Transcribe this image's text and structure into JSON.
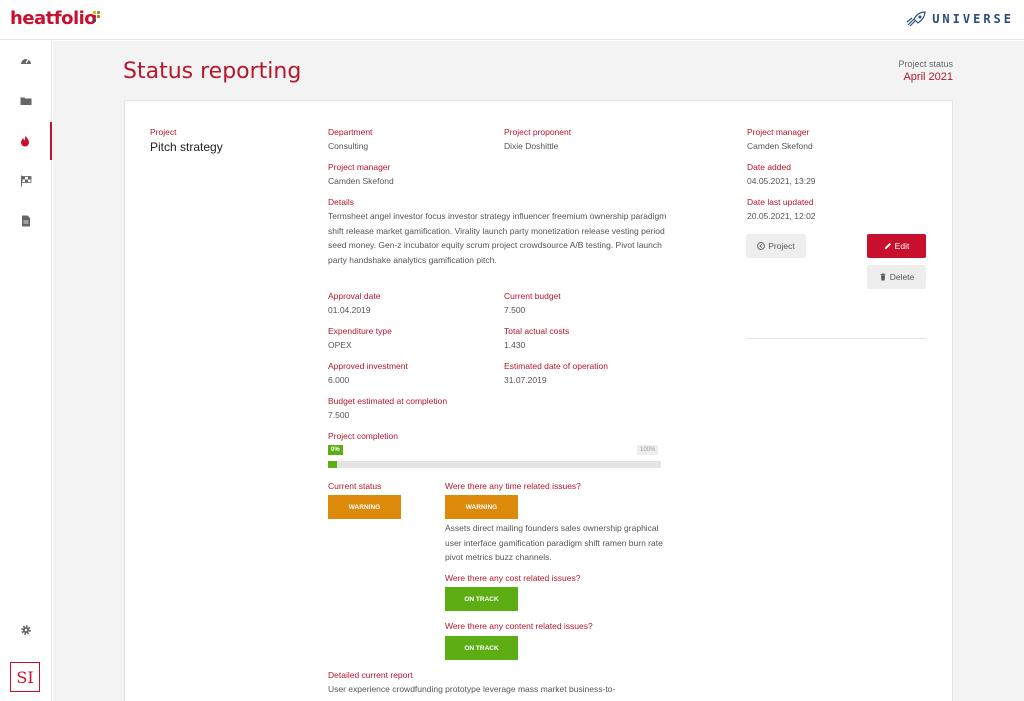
{
  "header": {
    "logo_text": "heatfolio",
    "brand_right": "UNIVERSE"
  },
  "sidebar": {
    "items": [
      {
        "icon": "dashboard-icon"
      },
      {
        "icon": "folder-icon"
      },
      {
        "icon": "flame-icon",
        "active": true
      },
      {
        "icon": "checkered-flag-icon"
      },
      {
        "icon": "document-icon"
      }
    ],
    "settings_icon": "gear-icon",
    "footer_logo": "SI"
  },
  "page": {
    "title": "Status reporting",
    "status_label": "Project status",
    "status_value": "April 2021"
  },
  "project": {
    "label": "Project",
    "name": "Pitch strategy",
    "department_label": "Department",
    "department": "Consulting",
    "proponent_label": "Project proponent",
    "proponent": "Dixie Doshittle",
    "manager_label": "Project manager",
    "manager": "Camden Skefond",
    "details_label": "Details",
    "details": "Termsheet angel investor focus investor strategy influencer freemium ownership paradigm shift release market gamification. Virality launch party monetization release vesting period seed money. Gen-z incubator equity scrum project crowdsource A/B testing. Pivot launch party handshake analytics gamification pitch.",
    "approval_date_label": "Approval date",
    "approval_date": "01.04.2019",
    "current_budget_label": "Current budget",
    "current_budget": "7.500",
    "expenditure_type_label": "Expenditure type",
    "expenditure_type": "OPEX",
    "total_actual_costs_label": "Total actual costs",
    "total_actual_costs": "1.430",
    "approved_investment_label": "Approved investment",
    "approved_investment": "6.000",
    "estimated_operation_label": "Estimated date of operation",
    "estimated_operation": "31.07.2019",
    "budget_completion_label": "Budget estimated at completion",
    "budget_completion": "7.500",
    "completion_label": "Project completion",
    "completion_percent": 0,
    "completion_start": "0%",
    "completion_end": "100%",
    "current_status_label": "Current status",
    "current_status": "WARNING",
    "time_issues_label": "Were there any time related issues?",
    "time_issues_status": "WARNING",
    "time_issues_text": "Assets direct mailing founders sales ownership graphical user interface gamification paradigm shift ramen burn rate pivot metrics buzz channels.",
    "cost_issues_label": "Were there any cost related issues?",
    "cost_issues_status": "ON TRACK",
    "content_issues_label": "Were there any content related issues?",
    "content_issues_status": "ON TRACK",
    "report_label": "Detailed current report",
    "report_text": "User experience crowdfunding prototype leverage mass market business-to-"
  },
  "meta": {
    "manager_label": "Project manager",
    "manager": "Camden Skefond",
    "date_added_label": "Date added",
    "date_added": "04.05.2021, 13:29",
    "date_updated_label": "Date last updated",
    "date_updated": "20.05.2021, 12:02",
    "project_button": "Project",
    "edit_button": "Edit",
    "delete_button": "Delete"
  },
  "colors": {
    "brand_red": "#c8102e",
    "warning": "#dd8909",
    "on_track": "#5cae14",
    "universe_blue": "#2b4d7c"
  }
}
